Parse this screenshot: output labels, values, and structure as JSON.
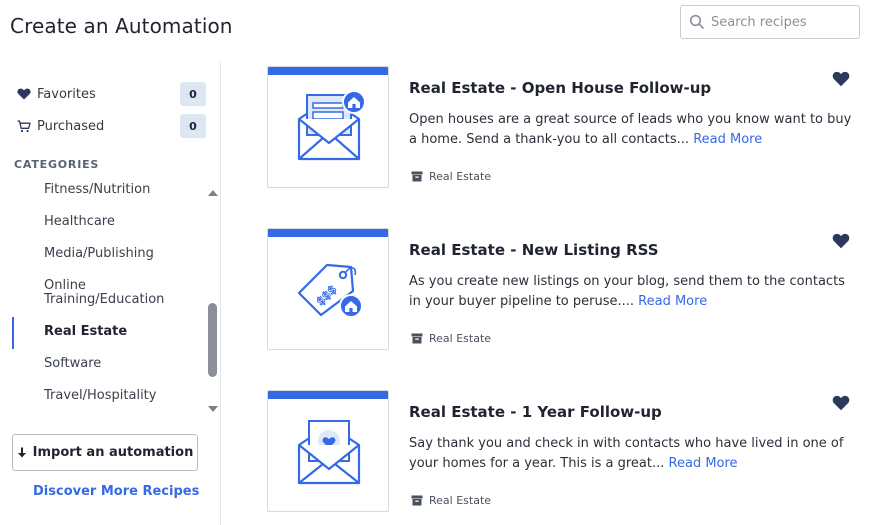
{
  "header": {
    "title": "Create an Automation",
    "search_placeholder": "Search recipes"
  },
  "sidebar": {
    "favorites": {
      "label": "Favorites",
      "count": "0"
    },
    "purchased": {
      "label": "Purchased",
      "count": "0"
    },
    "categories_heading": "CATEGORIES",
    "categories": [
      {
        "label": "Fitness/Nutrition"
      },
      {
        "label": "Healthcare"
      },
      {
        "label": "Media/Publishing"
      },
      {
        "label": "Online Training/Education"
      },
      {
        "label": "Real Estate",
        "active": true
      },
      {
        "label": "Software"
      },
      {
        "label": "Travel/Hospitality"
      }
    ],
    "import_label": "Import an automation",
    "discover_label": "Discover More Recipes"
  },
  "recipes": [
    {
      "title": "Real Estate - Open House Follow-up",
      "description": "Open houses are a great source of leads who you know want to buy a home. Send a thank-you to all contacts...",
      "read_more": "Read More",
      "category": "Real Estate",
      "icon": "envelope-house-icon"
    },
    {
      "title": "Real Estate - New Listing RSS",
      "description": "As you create new listings on your blog, send them to the contacts in your buyer pipeline to peruse....",
      "read_more": "Read More",
      "category": "Real Estate",
      "icon": "price-tag-house-icon"
    },
    {
      "title": "Real Estate - 1 Year Follow-up",
      "description": "Say thank you and check in with contacts who have lived in one of your homes for a year. This is a great...",
      "read_more": "Read More",
      "category": "Real Estate",
      "icon": "envelope-heart-icon"
    }
  ],
  "colors": {
    "accent": "#356ae6",
    "heart": "#2b3a5c",
    "badge_bg": "#dde6f3"
  }
}
